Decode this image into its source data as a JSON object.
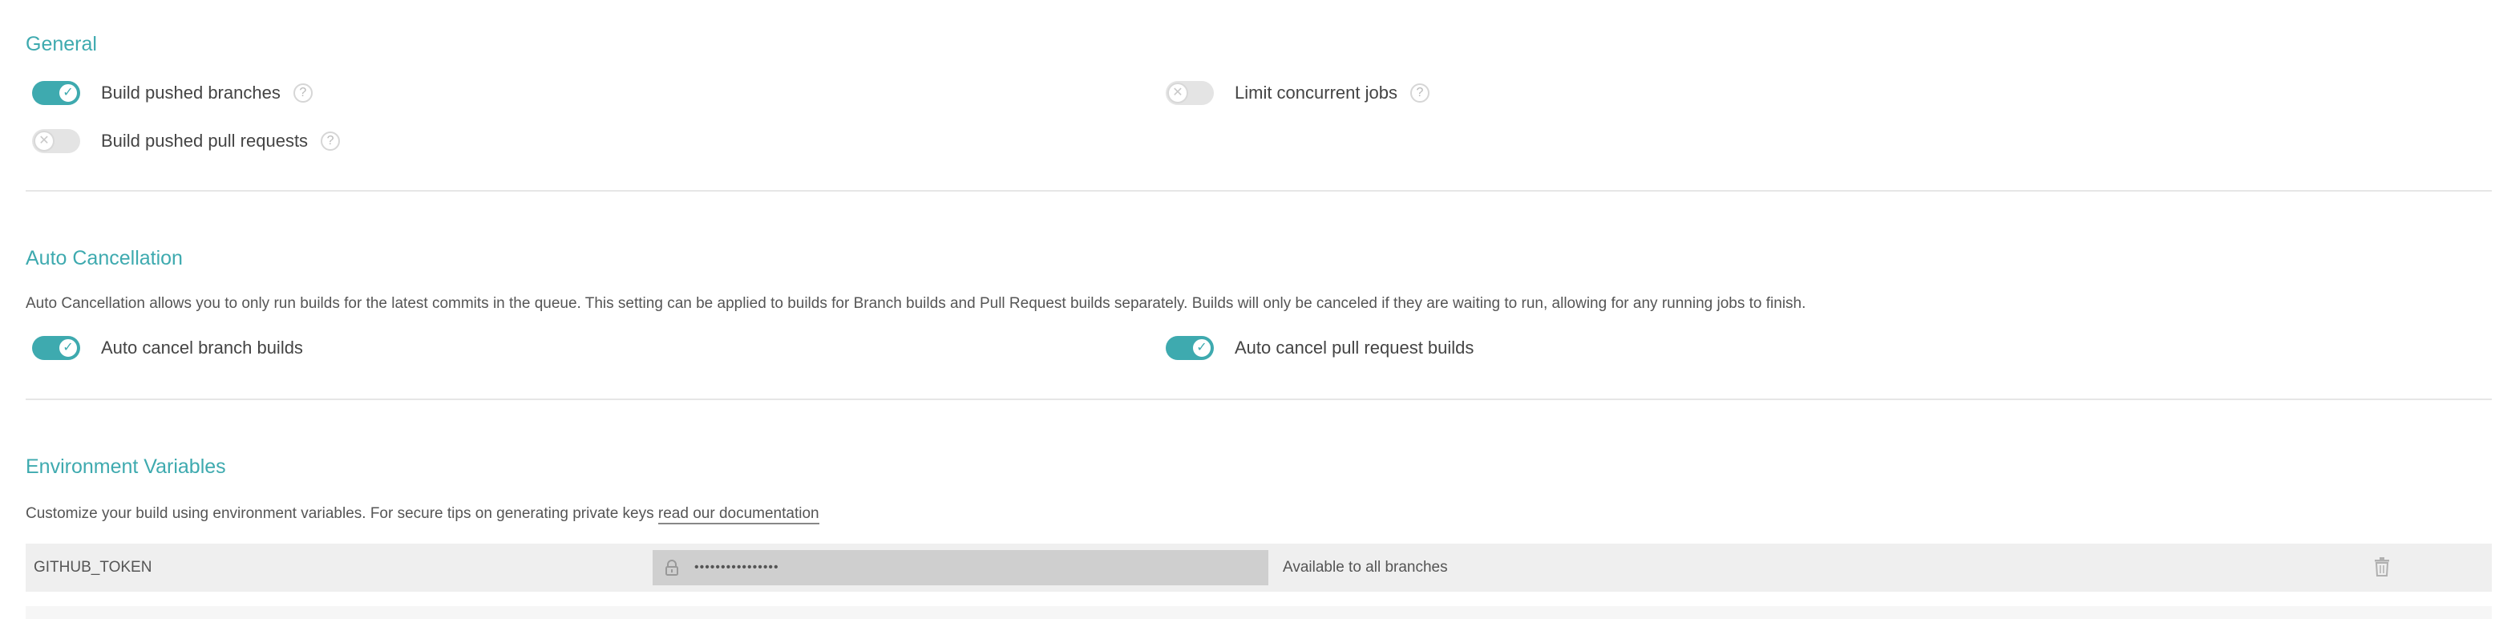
{
  "general": {
    "title": "General",
    "build_pushed_branches": {
      "label": "Build pushed branches",
      "enabled": true,
      "help": "?"
    },
    "build_pushed_pull_requests": {
      "label": "Build pushed pull requests",
      "enabled": false,
      "help": "?"
    },
    "limit_concurrent_jobs": {
      "label": "Limit concurrent jobs",
      "enabled": false,
      "help": "?"
    }
  },
  "auto_cancellation": {
    "title": "Auto Cancellation",
    "description": "Auto Cancellation allows you to only run builds for the latest commits in the queue. This setting can be applied to builds for Branch builds and Pull Request builds separately. Builds will only be canceled if they are waiting to run, allowing for any running jobs to finish.",
    "branch_builds": {
      "label": "Auto cancel branch builds",
      "enabled": true
    },
    "pull_request_builds": {
      "label": "Auto cancel pull request builds",
      "enabled": true
    }
  },
  "environment_variables": {
    "title": "Environment Variables",
    "description": "Customize your build using environment variables. For secure tips on generating private keys",
    "doc_link": "read our documentation",
    "rows": [
      {
        "name": "GITHUB_TOKEN",
        "value_masked": "••••••••••••••••",
        "branch": "Available to all branches"
      }
    ]
  },
  "icons": {
    "check": "check-icon",
    "cross": "cross-icon",
    "help": "question-mark-icon",
    "lock": "lock-icon",
    "trash": "trash-icon"
  },
  "colors": {
    "accent": "#3eaaaf",
    "toggle_off": "#e4e4e4",
    "row_background": "#efefef",
    "masked_field": "#cfcfcf"
  }
}
